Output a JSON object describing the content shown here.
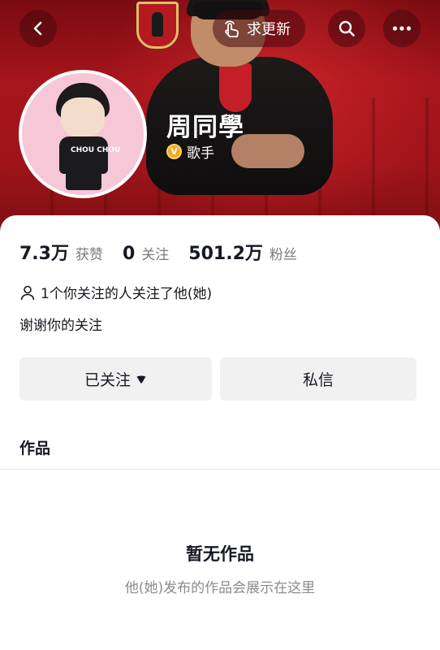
{
  "header": {
    "update_label": "求更新"
  },
  "profile": {
    "name": "周同學",
    "verified_title": "歌手",
    "verify_icon_letter": "V"
  },
  "stats": {
    "likes_value": "7.3万",
    "likes_label": "获赞",
    "following_value": "0",
    "following_label": "关注",
    "followers_value": "501.2万",
    "followers_label": "粉丝"
  },
  "mutual_text": "1个你关注的人关注了他(她)",
  "signature": "谢谢你的关注",
  "actions": {
    "follow_label": "已关注",
    "message_label": "私信"
  },
  "works": {
    "tab_label": "作品",
    "empty_title": "暂无作品",
    "empty_subtitle": "他(她)发布的作品会展示在这里"
  },
  "avatar_text": "CHOU CHOU",
  "colors": {
    "banner_red": "#a6151c",
    "verify_gold": "#f3a81e",
    "button_gray": "#f1f1f2",
    "text_primary": "#161823",
    "text_secondary": "#7a7b80"
  },
  "icons": [
    "back-arrow-icon",
    "hand-pointer-icon",
    "search-icon",
    "more-dots-icon",
    "verified-v-icon",
    "person-outline-icon",
    "caret-down-icon"
  ]
}
